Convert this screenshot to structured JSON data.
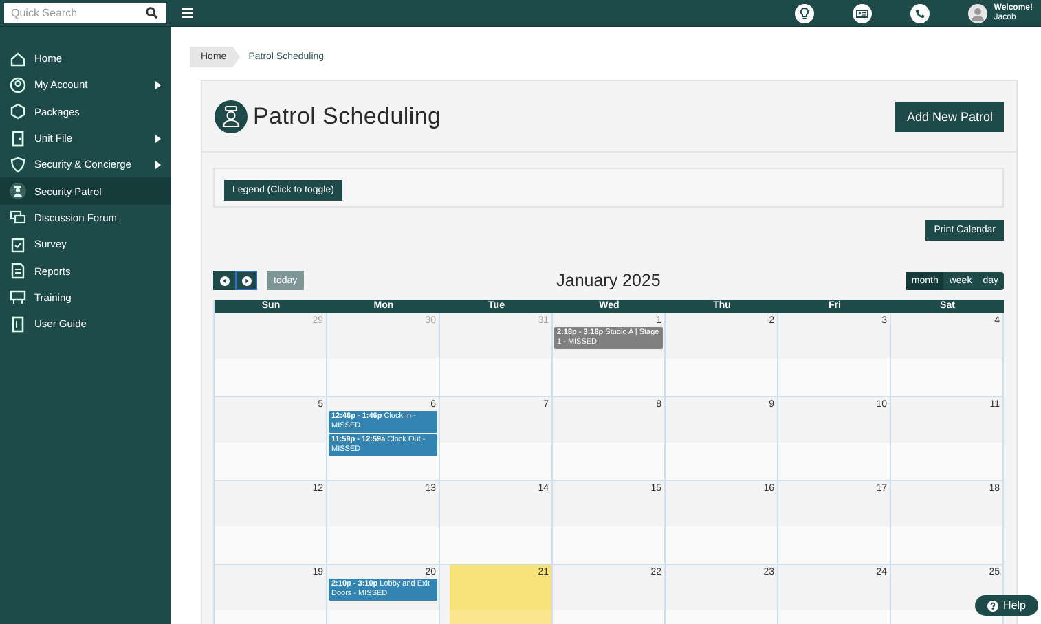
{
  "search": {
    "placeholder": "Quick Search"
  },
  "user": {
    "greeting": "Welcome!",
    "name": "Jacob"
  },
  "sidebar": {
    "items": [
      {
        "label": "Home",
        "has_submenu": false,
        "selected": false
      },
      {
        "label": "My Account",
        "has_submenu": true,
        "selected": false
      },
      {
        "label": "Packages",
        "has_submenu": false,
        "selected": false
      },
      {
        "label": "Unit File",
        "has_submenu": true,
        "selected": false
      },
      {
        "label": "Security & Concierge",
        "has_submenu": true,
        "selected": false
      },
      {
        "label": "Security Patrol",
        "has_submenu": false,
        "selected": true
      },
      {
        "label": "Discussion Forum",
        "has_submenu": false,
        "selected": false
      },
      {
        "label": "Survey",
        "has_submenu": false,
        "selected": false
      },
      {
        "label": "Reports",
        "has_submenu": false,
        "selected": false
      },
      {
        "label": "Training",
        "has_submenu": false,
        "selected": false
      },
      {
        "label": "User Guide",
        "has_submenu": false,
        "selected": false
      }
    ]
  },
  "breadcrumb": [
    "Home",
    "Patrol Scheduling"
  ],
  "page": {
    "title": "Patrol Scheduling",
    "add_button": "Add New Patrol",
    "legend_button": "Legend (Click to toggle)",
    "print_button": "Print Calendar"
  },
  "calendar": {
    "title": "January 2025",
    "today_button": "today",
    "views": [
      {
        "label": "month",
        "selected": true
      },
      {
        "label": "week",
        "selected": false
      },
      {
        "label": "day",
        "selected": false
      }
    ],
    "weekdays": [
      "Sun",
      "Mon",
      "Tue",
      "Wed",
      "Thu",
      "Fri",
      "Sat"
    ],
    "weeks": [
      {
        "days": [
          {
            "day": "29",
            "other_month": true,
            "today": false
          },
          {
            "day": "30",
            "other_month": true,
            "today": false
          },
          {
            "day": "31",
            "other_month": true,
            "today": false
          },
          {
            "day": "1",
            "other_month": false,
            "today": false,
            "events": [
              {
                "time": "2:18p - 3:18p",
                "text": "Studio A | Stage 1 - MISSED",
                "color": "#808080"
              }
            ]
          },
          {
            "day": "2",
            "other_month": false,
            "today": false
          },
          {
            "day": "3",
            "other_month": false,
            "today": false
          },
          {
            "day": "4",
            "other_month": false,
            "today": false
          }
        ]
      },
      {
        "days": [
          {
            "day": "5",
            "other_month": false,
            "today": false
          },
          {
            "day": "6",
            "other_month": false,
            "today": false,
            "events": [
              {
                "time": "12:46p - 1:46p",
                "text": "Clock In - MISSED",
                "color": "#3384b0"
              },
              {
                "time": "11:59p - 12:59a",
                "text": "Clock Out - MISSED",
                "color": "#3384b0"
              }
            ]
          },
          {
            "day": "7",
            "other_month": false,
            "today": false
          },
          {
            "day": "8",
            "other_month": false,
            "today": false
          },
          {
            "day": "9",
            "other_month": false,
            "today": false
          },
          {
            "day": "10",
            "other_month": false,
            "today": false
          },
          {
            "day": "11",
            "other_month": false,
            "today": false
          }
        ]
      },
      {
        "days": [
          {
            "day": "12",
            "other_month": false,
            "today": false
          },
          {
            "day": "13",
            "other_month": false,
            "today": false
          },
          {
            "day": "14",
            "other_month": false,
            "today": false
          },
          {
            "day": "15",
            "other_month": false,
            "today": false
          },
          {
            "day": "16",
            "other_month": false,
            "today": false
          },
          {
            "day": "17",
            "other_month": false,
            "today": false
          },
          {
            "day": "18",
            "other_month": false,
            "today": false
          }
        ]
      },
      {
        "days": [
          {
            "day": "19",
            "other_month": false,
            "today": false
          },
          {
            "day": "20",
            "other_month": false,
            "today": false,
            "events": [
              {
                "time": "2:10p - 3:10p",
                "text": "Lobby and Exit Doors - MISSED",
                "color": "#3384b0"
              }
            ]
          },
          {
            "day": "21",
            "other_month": false,
            "today": true
          },
          {
            "day": "22",
            "other_month": false,
            "today": false
          },
          {
            "day": "23",
            "other_month": false,
            "today": false
          },
          {
            "day": "24",
            "other_month": false,
            "today": false
          },
          {
            "day": "25",
            "other_month": false,
            "today": false
          }
        ]
      }
    ]
  },
  "help_button": "Help"
}
